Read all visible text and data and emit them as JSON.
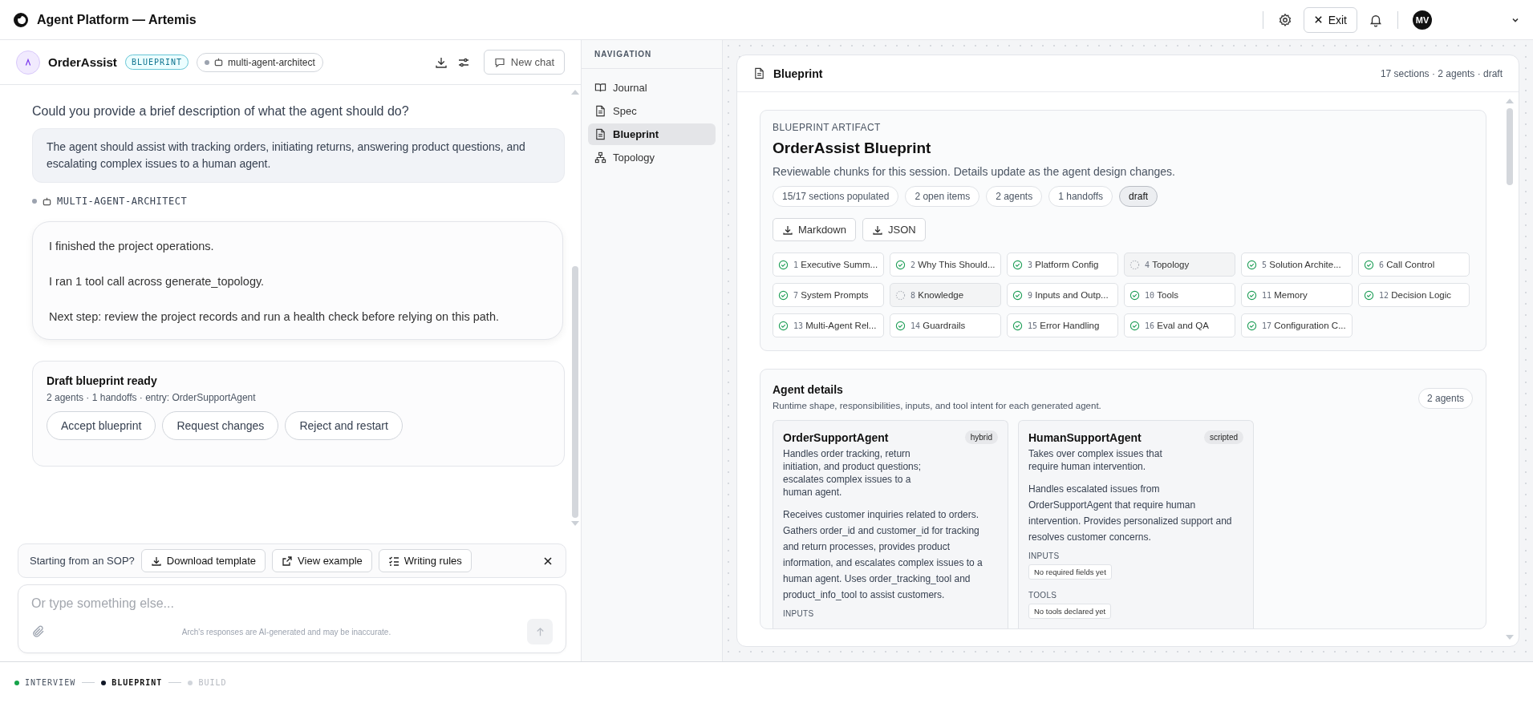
{
  "app": {
    "title": "Agent Platform — Artemis",
    "exit_label": "Exit",
    "avatar_initials": "MV"
  },
  "chat": {
    "agent_name": "OrderAssist",
    "stage_badge": "BLUEPRINT",
    "architect_chip": "multi-agent-architect",
    "new_chat_label": "New chat",
    "messages": [
      {
        "kind": "question",
        "text": "Could you provide a brief description of what the agent should do?"
      },
      {
        "kind": "user",
        "text": "The agent should assist with tracking orders, initiating returns, answering product questions, and escalating complex issues to a human agent."
      },
      {
        "kind": "sender",
        "text": "MULTI-AGENT-ARCHITECT"
      },
      {
        "kind": "assistant",
        "paragraphs": [
          "I finished the project operations.",
          "I ran 1 tool call across generate_topology.",
          "Next step: review the project records and run a health check before relying on this path."
        ]
      },
      {
        "kind": "review",
        "title": "Draft blueprint ready",
        "meta": "2 agents · 1 handoffs · entry: OrderSupportAgent",
        "actions": [
          "Accept blueprint",
          "Request changes",
          "Reject and restart"
        ]
      }
    ],
    "sop": {
      "prompt": "Starting from an SOP?",
      "actions": [
        {
          "kind": "download",
          "label": "Download template"
        },
        {
          "kind": "external",
          "label": "View example"
        },
        {
          "kind": "list",
          "label": "Writing rules"
        }
      ]
    },
    "input": {
      "placeholder": "Or type something else...",
      "disclaimer": "Arch's responses are AI-generated and may be inaccurate."
    }
  },
  "navigation": {
    "heading": "NAVIGATION",
    "items": [
      {
        "kind": "book",
        "label": "Journal",
        "selected": false
      },
      {
        "kind": "doc",
        "label": "Spec",
        "selected": false
      },
      {
        "kind": "doc",
        "label": "Blueprint",
        "selected": true
      },
      {
        "kind": "tree",
        "label": "Topology",
        "selected": false
      }
    ]
  },
  "blueprint": {
    "title": "Blueprint",
    "summary": "17 sections · 2 agents · draft",
    "artifact": {
      "eyebrow": "BLUEPRINT ARTIFACT",
      "title": "OrderAssist Blueprint",
      "description": "Reviewable chunks for this session. Details update as the agent design changes.",
      "chips": [
        {
          "label": "15/17 sections populated",
          "selected": false
        },
        {
          "label": "2 open items",
          "selected": false
        },
        {
          "label": "2 agents",
          "selected": false
        },
        {
          "label": "1 handoffs",
          "selected": false
        },
        {
          "label": "draft",
          "selected": true
        }
      ],
      "exports": [
        "Markdown",
        "JSON"
      ],
      "sections": [
        {
          "number": "1",
          "label": "Executive Summ...",
          "complete": true
        },
        {
          "number": "2",
          "label": "Why This Should...",
          "complete": true
        },
        {
          "number": "3",
          "label": "Platform Config",
          "complete": true
        },
        {
          "number": "4",
          "label": "Topology",
          "complete": false
        },
        {
          "number": "5",
          "label": "Solution Archite...",
          "complete": true
        },
        {
          "number": "6",
          "label": "Call Control",
          "complete": true
        },
        {
          "number": "7",
          "label": "System Prompts",
          "complete": true
        },
        {
          "number": "8",
          "label": "Knowledge",
          "complete": false
        },
        {
          "number": "9",
          "label": "Inputs and Outp...",
          "complete": true
        },
        {
          "number": "10",
          "label": "Tools",
          "complete": true
        },
        {
          "number": "11",
          "label": "Memory",
          "complete": true
        },
        {
          "number": "12",
          "label": "Decision Logic",
          "complete": true
        },
        {
          "number": "13",
          "label": "Multi-Agent Rel...",
          "complete": true
        },
        {
          "number": "14",
          "label": "Guardrails",
          "complete": true
        },
        {
          "number": "15",
          "label": "Error Handling",
          "complete": true
        },
        {
          "number": "16",
          "label": "Eval and QA",
          "complete": true
        },
        {
          "number": "17",
          "label": "Configuration C...",
          "complete": true
        }
      ]
    },
    "agent_details": {
      "title": "Agent details",
      "description": "Runtime shape, responsibilities, inputs, and tool intent for each generated agent.",
      "count": "2 agents",
      "agents": [
        {
          "name": "OrderSupportAgent",
          "mode": "hybrid",
          "summary": "Handles order tracking, return initiation, and product questions; escalates complex issues to a human agent.",
          "details": "Receives customer inquiries related to orders. Gathers order_id and customer_id for tracking and return processes, provides product information, and escalates complex issues to a human agent. Uses order_tracking_tool and product_info_tool to assist customers.",
          "fields": [
            {
              "label": "INPUTS"
            }
          ]
        },
        {
          "name": "HumanSupportAgent",
          "mode": "scripted",
          "summary": "Takes over complex issues that require human intervention.",
          "details": "Handles escalated issues from OrderSupportAgent that require human intervention. Provides personalized support and resolves customer concerns.",
          "fields": [
            {
              "label": "INPUTS",
              "value": "No required fields yet"
            },
            {
              "label": "TOOLS",
              "value": "No tools declared yet"
            }
          ]
        }
      ]
    }
  },
  "stepper": [
    {
      "label": "INTERVIEW",
      "completed": true,
      "selected": false
    },
    {
      "label": "BLUEPRINT",
      "completed": false,
      "selected": true
    },
    {
      "label": "BUILD",
      "completed": false,
      "selected": false
    }
  ]
}
